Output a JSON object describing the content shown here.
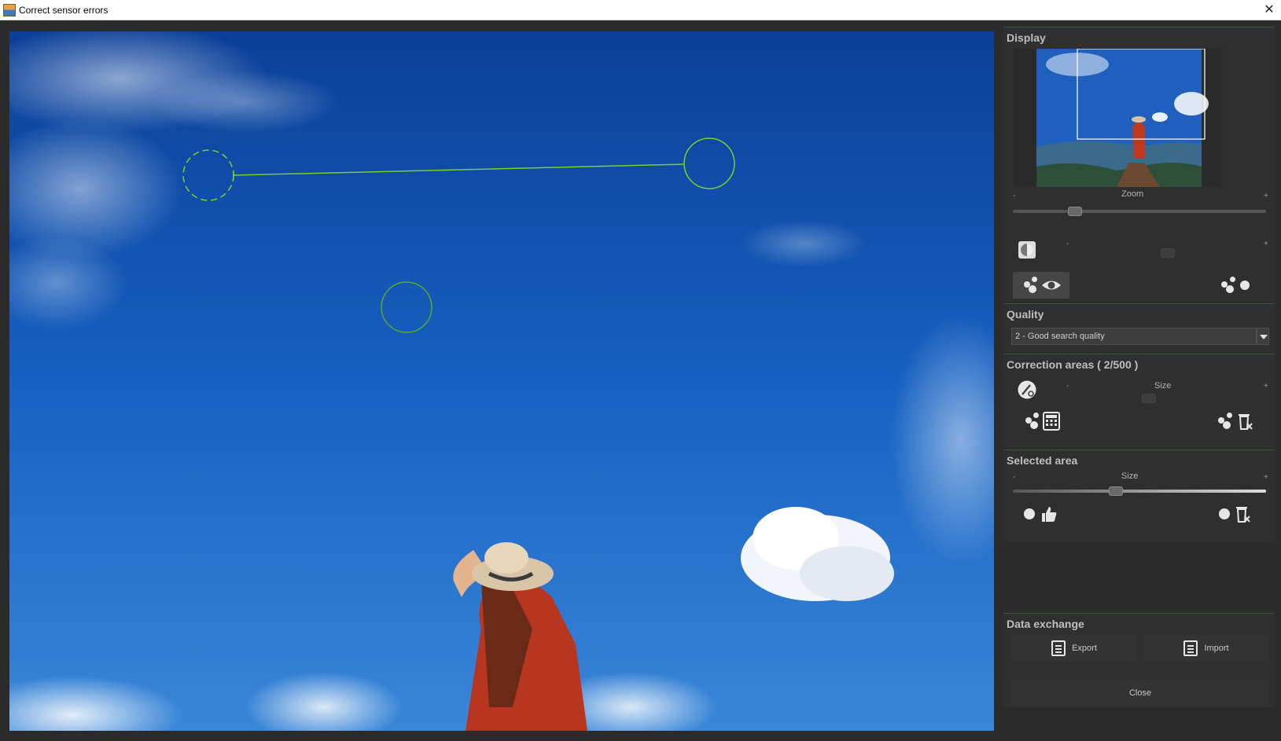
{
  "window": {
    "title": "Correct sensor errors",
    "close_icon": "close-icon"
  },
  "display": {
    "title": "Display",
    "zoom_label": "Zoom",
    "zoom_minus": "-",
    "zoom_plus": "+",
    "zoom_level": 0.23,
    "contrast_minus": "-",
    "contrast_plus": "+"
  },
  "quality": {
    "title": "Quality",
    "selected": "2 - Good search quality"
  },
  "correction_areas": {
    "title": "Correction areas",
    "count": "( 2/500 )",
    "size_label": "Size",
    "size_minus": "-",
    "size_plus": "+"
  },
  "selected_area": {
    "title": "Selected area",
    "size_label": "Size",
    "size_minus": "-",
    "size_plus": "+",
    "size_level": 0.4
  },
  "data_exchange": {
    "title": "Data exchange",
    "export_label": "Export",
    "import_label": "Import"
  },
  "footer": {
    "close_label": "Close"
  },
  "colors": {
    "accent_green": "#5fbf2a",
    "panel_bg": "#2f2f2f",
    "sky": "#1659b8"
  }
}
